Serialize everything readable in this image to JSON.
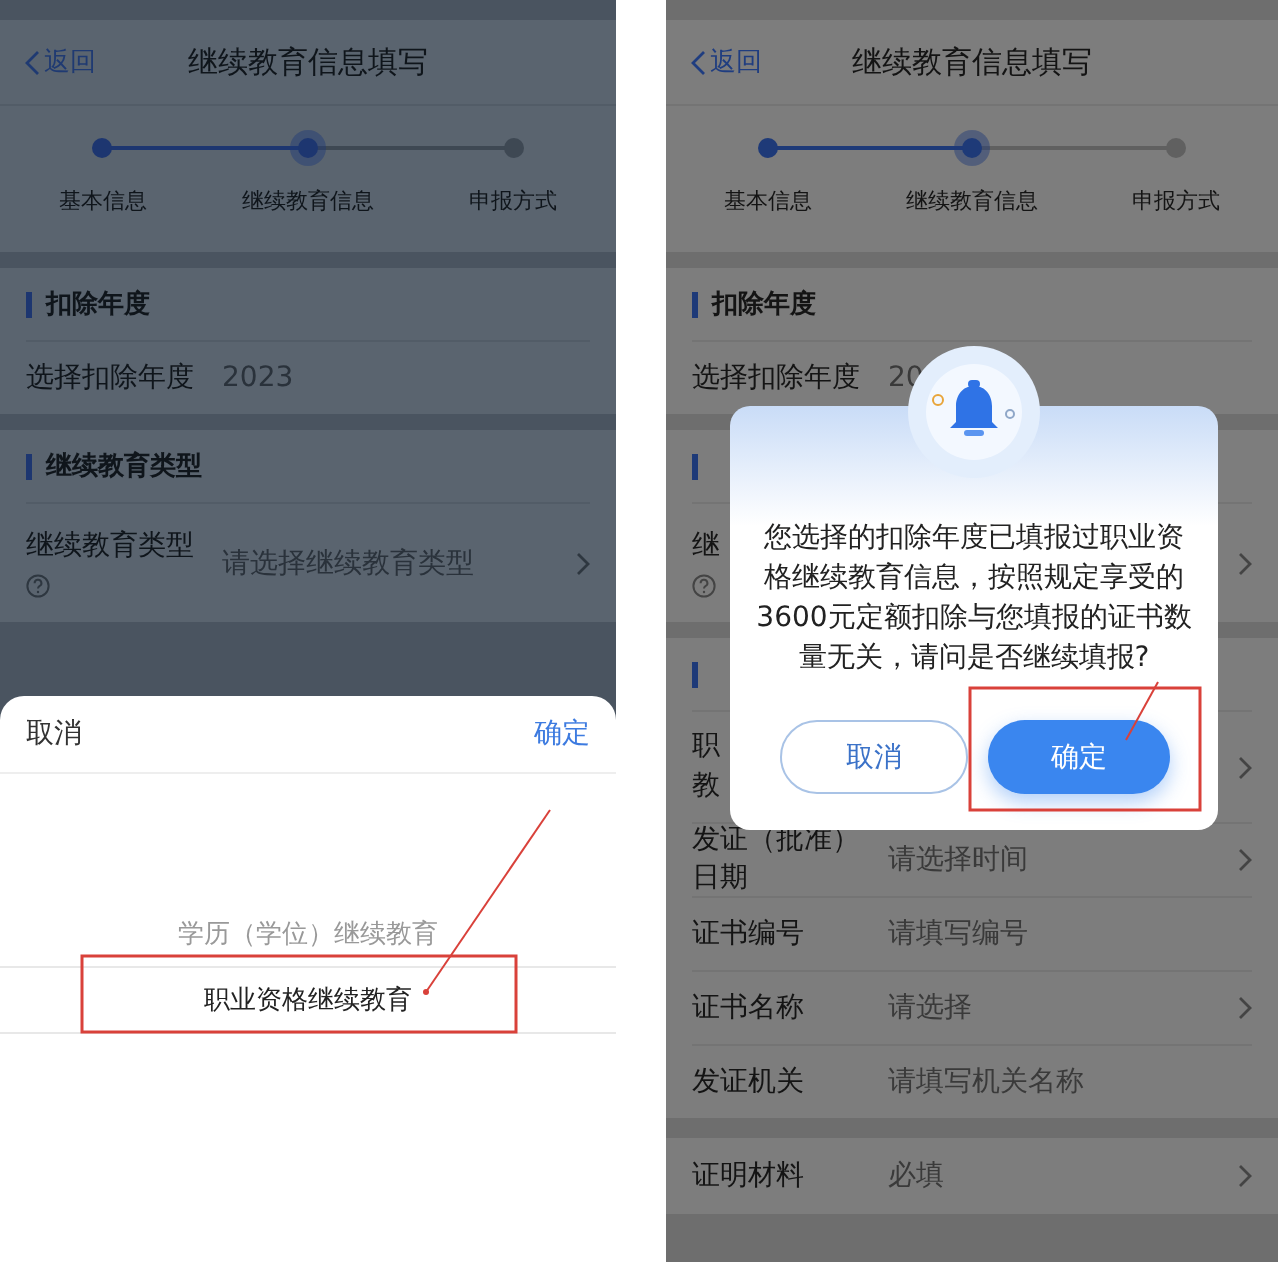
{
  "screens": [
    {
      "kind": "picker",
      "nav": {
        "back": "返回",
        "title": "继续教育信息填写"
      },
      "steps": [
        {
          "label": "基本信息",
          "done": true,
          "current": false
        },
        {
          "label": "继续教育信息",
          "done": false,
          "current": true
        },
        {
          "label": "申报方式",
          "done": false,
          "current": false
        }
      ],
      "sections": [
        {
          "header": true,
          "title": "扣除年度",
          "rows": [
            {
              "label": "选择扣除年度",
              "value": "2023",
              "chevron": false,
              "help": false
            }
          ]
        },
        {
          "header": true,
          "title": "继续教育类型",
          "rows": [
            {
              "label": "继续教育类型",
              "placeholder": "请选择继续教育类型",
              "chevron": true,
              "help": true
            }
          ]
        }
      ],
      "sheet": {
        "cancel": "取消",
        "confirm": "确定",
        "options": [
          {
            "label": "学历（学位）继续教育",
            "selected": false
          },
          {
            "label": "职业资格继续教育",
            "selected": true
          }
        ]
      }
    },
    {
      "kind": "dialog",
      "nav": {
        "back": "返回",
        "title": "继续教育信息填写"
      },
      "steps": [
        {
          "label": "基本信息",
          "done": true,
          "current": false
        },
        {
          "label": "继续教育信息",
          "done": false,
          "current": true
        },
        {
          "label": "申报方式",
          "done": false,
          "current": false
        }
      ],
      "sections": [
        {
          "header": true,
          "title": "扣除年度",
          "rows": [
            {
              "label": "选择扣除年度",
              "value": "20",
              "chevron": false,
              "help": false
            }
          ]
        },
        {
          "header": true,
          "rows": [
            {
              "label": "继",
              "chevron": true,
              "help": true
            }
          ]
        },
        {
          "header": true,
          "rows": [
            {
              "label_lines": [
                "职",
                "教"
              ],
              "chevron": true,
              "help": false
            },
            {
              "label": "发证（批准）日期",
              "placeholder": "请选择时间",
              "chevron": true,
              "help": false
            },
            {
              "label": "证书编号",
              "placeholder": "请填写编号",
              "chevron": false,
              "help": false
            },
            {
              "label": "证书名称",
              "placeholder": "请选择",
              "chevron": true,
              "help": false
            },
            {
              "label": "发证机关",
              "placeholder": "请填写机关名称",
              "chevron": false,
              "help": false
            }
          ]
        },
        {
          "header": false,
          "rows": [
            {
              "label": "证明材料",
              "placeholder": "必填",
              "chevron": true,
              "help": false
            }
          ]
        }
      ],
      "dialog": {
        "message": "您选择的扣除年度已填报过职业资格继续教育信息，按照规定享受的3600元定额扣除与您填报的证书数量无关，请问是否继续填报?",
        "cancel": "取消",
        "confirm": "确定"
      }
    }
  ]
}
